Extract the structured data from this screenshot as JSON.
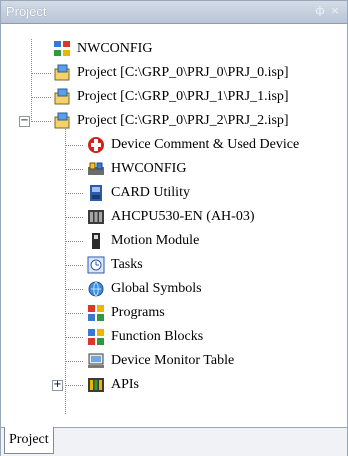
{
  "panel": {
    "title": "Project",
    "pin_glyph": "ф",
    "close_glyph": "×"
  },
  "tree": {
    "root": "NWCONFIG",
    "projects": [
      "Project [C:\\GRP_0\\PRJ_0\\PRJ_0.isp]",
      "Project [C:\\GRP_0\\PRJ_1\\PRJ_1.isp]",
      "Project [C:\\GRP_0\\PRJ_2\\PRJ_2.isp]"
    ],
    "expanded_project_expander": "−",
    "children": [
      {
        "label": "Device Comment & Used Device",
        "icon": "device-comment-icon"
      },
      {
        "label": "HWCONFIG",
        "icon": "hwconfig-icon"
      },
      {
        "label": "CARD Utility",
        "icon": "card-utility-icon"
      },
      {
        "label": "AHCPU530-EN  (AH-03)",
        "icon": "cpu-module-icon"
      },
      {
        "label": "Motion Module",
        "icon": "motion-module-icon"
      },
      {
        "label": "Tasks",
        "icon": "tasks-icon"
      },
      {
        "label": "Global Symbols",
        "icon": "global-symbols-icon"
      },
      {
        "label": "Programs",
        "icon": "programs-icon"
      },
      {
        "label": "Function Blocks",
        "icon": "function-blocks-icon"
      },
      {
        "label": "Device Monitor Table",
        "icon": "device-monitor-table-icon"
      },
      {
        "label": "APIs",
        "icon": "apis-icon"
      }
    ],
    "apis_expander": "+"
  },
  "tabs": [
    {
      "label": "Project"
    }
  ]
}
